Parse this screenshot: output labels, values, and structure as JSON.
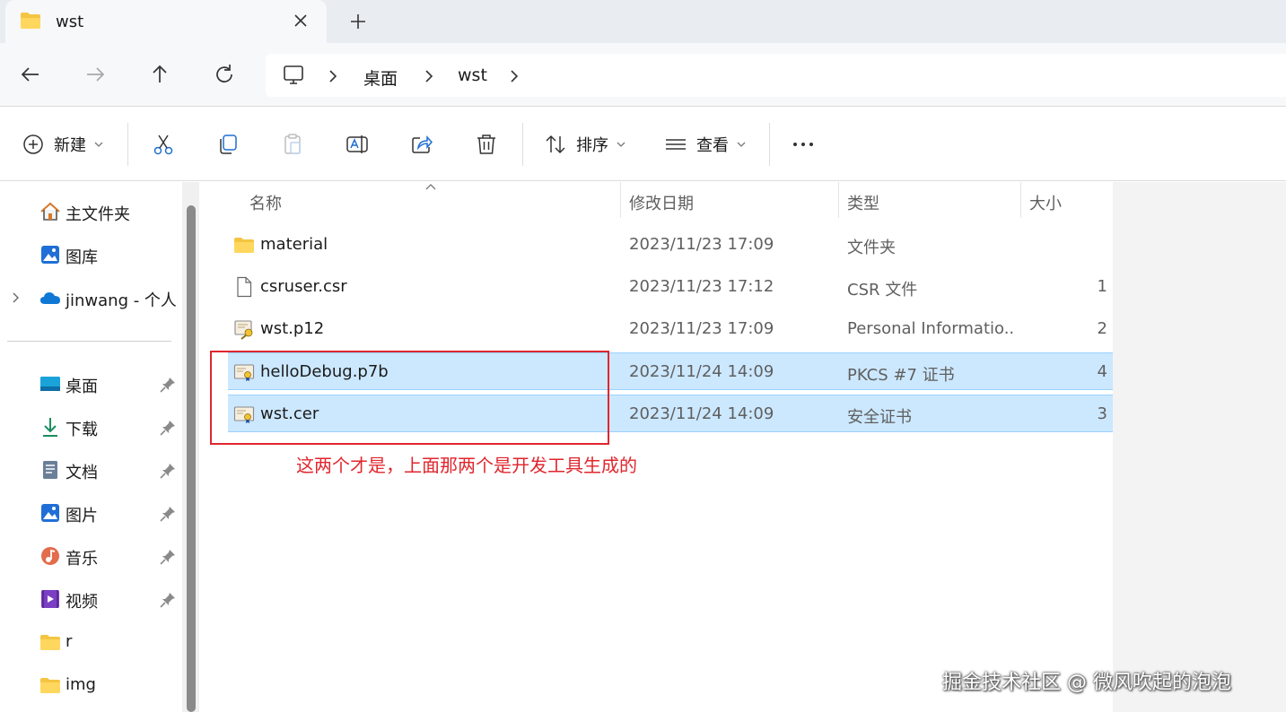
{
  "tab": {
    "title": "wst"
  },
  "address": {
    "items": [
      "桌面",
      "wst"
    ]
  },
  "commands": {
    "new_label": "新建",
    "sort_label": "排序",
    "view_label": "查看"
  },
  "sidebar": {
    "quick": [
      {
        "label": "主文件夹",
        "icon": "home-icon"
      },
      {
        "label": "图库",
        "icon": "gallery-icon"
      },
      {
        "label": "jinwang - 个人",
        "icon": "onedrive-cloud-icon"
      }
    ],
    "pinned": [
      {
        "label": "桌面",
        "icon": "desktop-icon",
        "pinned": true
      },
      {
        "label": "下载",
        "icon": "download-icon",
        "pinned": true
      },
      {
        "label": "文档",
        "icon": "document-icon",
        "pinned": true
      },
      {
        "label": "图片",
        "icon": "pictures-icon",
        "pinned": true
      },
      {
        "label": "音乐",
        "icon": "music-icon",
        "pinned": true
      },
      {
        "label": "视频",
        "icon": "video-icon",
        "pinned": true
      },
      {
        "label": "r",
        "icon": "folder-icon",
        "pinned": false
      },
      {
        "label": "img",
        "icon": "folder-icon",
        "pinned": false
      }
    ]
  },
  "columns": {
    "name": "名称",
    "date": "修改日期",
    "type": "类型",
    "size": "大小"
  },
  "files": [
    {
      "name": "material",
      "date": "2023/11/23 17:09",
      "type": "文件夹",
      "size": "",
      "icon": "folder-icon",
      "selected": false
    },
    {
      "name": "csruser.csr",
      "date": "2023/11/23 17:12",
      "type": "CSR 文件",
      "size": "1",
      "icon": "file-icon",
      "selected": false
    },
    {
      "name": "wst.p12",
      "date": "2023/11/23 17:09",
      "type": "Personal Informatio...",
      "size": "2",
      "icon": "certificate-key-icon",
      "selected": false
    },
    {
      "name": "helloDebug.p7b",
      "date": "2023/11/24 14:09",
      "type": "PKCS #7 证书",
      "size": "4",
      "icon": "certificate-icon",
      "selected": true
    },
    {
      "name": "wst.cer",
      "date": "2023/11/24 14:09",
      "type": "安全证书",
      "size": "3",
      "icon": "certificate-icon",
      "selected": true
    }
  ],
  "annotation": {
    "note": "这两个才是，上面那两个是开发工具生成的"
  },
  "watermark": "掘金技术社区 @ 微风吹起的泡泡",
  "colors": {
    "selection": "#cce8ff",
    "annotation": "#e0262d",
    "folder": "#f4c542"
  }
}
